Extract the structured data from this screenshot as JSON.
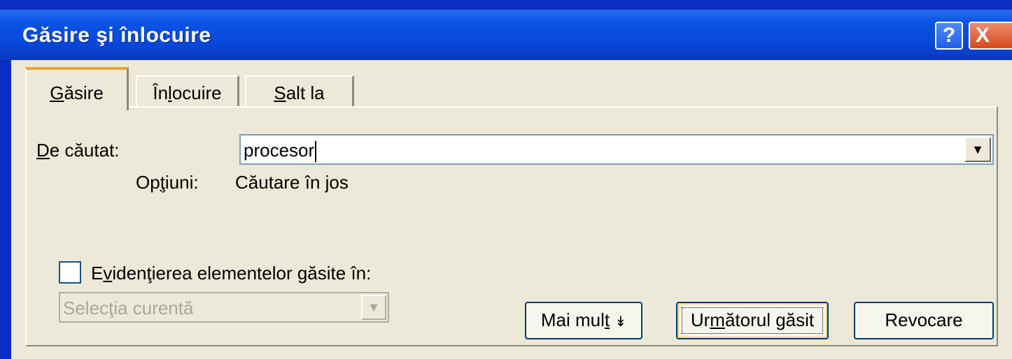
{
  "window": {
    "title": "Găsire şi înlocuire",
    "help_button_icon": "?",
    "close_button_icon": "X"
  },
  "tabs": [
    {
      "pre": "",
      "u": "G",
      "post": "ăsire",
      "active": true
    },
    {
      "pre": "În",
      "u": "l",
      "post": "ocuire",
      "active": false
    },
    {
      "pre": "",
      "u": "S",
      "post": "alt la",
      "active": false
    }
  ],
  "find": {
    "label_u": "D",
    "label_rest": "e căutat:",
    "value": "procesor",
    "dropdown_icon": "▼"
  },
  "options": {
    "label_pre": "Op",
    "label_u": "ţ",
    "label_post": "iuni:",
    "value": "Căutare în jos"
  },
  "highlight": {
    "checked": false,
    "label_pre": "E",
    "label_u": "v",
    "label_post": "idenţierea elementelor găsite în:",
    "select_value": "Selecţia curentă",
    "dropdown_icon": "▼"
  },
  "buttons": {
    "more_pre": "Mai mul",
    "more_u": "t",
    "more_icon": "↡",
    "next_pre": "Ur",
    "next_u": "m",
    "next_post": "ătorul găsit",
    "cancel": "Revocare"
  },
  "colors": {
    "titlebar": "#0a54e3",
    "dialog_bg": "#ece9d8",
    "close_button": "#d64a1e",
    "default_button_highlight": "#ffd27a"
  }
}
